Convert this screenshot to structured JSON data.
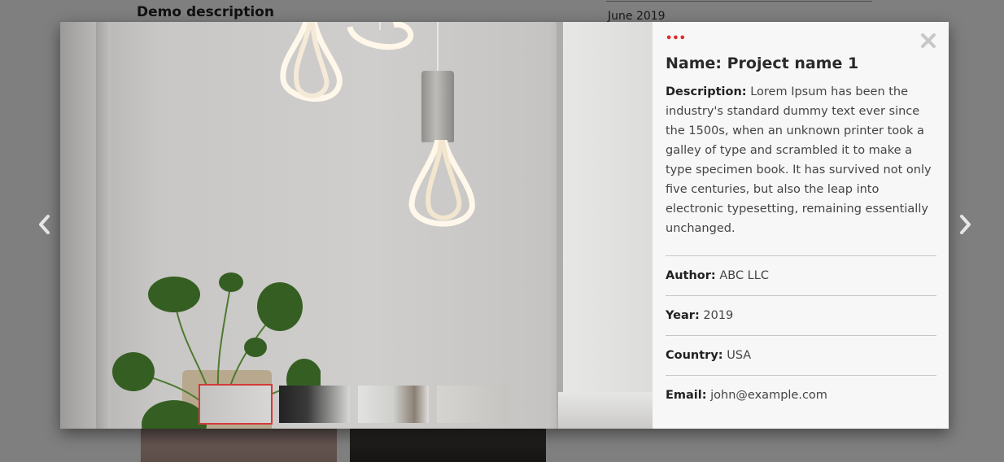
{
  "background": {
    "heading": "Demo description",
    "date": "June 2019"
  },
  "lightbox": {
    "nav": {
      "prev_icon": "chevron-left-icon",
      "next_icon": "chevron-right-icon"
    },
    "close_icon": "close-icon",
    "menu_dots": "•••",
    "thumbnails": [
      {
        "name": "thumb-1",
        "active": true
      },
      {
        "name": "thumb-2",
        "active": false
      },
      {
        "name": "thumb-3",
        "active": false
      },
      {
        "name": "thumb-4",
        "active": false
      }
    ],
    "info": {
      "title": "Name: Project name 1",
      "description_label": "Description:",
      "description_text": " Lorem Ipsum has been the industry's standard dummy text ever since the 1500s, when an unknown printer took a galley of type and scrambled it to make a type specimen book. It has survived not only five centuries, but also the leap into electronic typesetting, remaining essentially unchanged.",
      "fields": [
        {
          "label": "Author:",
          "value": " ABC LLC"
        },
        {
          "label": "Year:",
          "value": " 2019"
        },
        {
          "label": "Country:",
          "value": " USA"
        },
        {
          "label": "Email:",
          "value": " john@example.com"
        }
      ]
    },
    "colors": {
      "accent": "#d23a3a",
      "panel_bg": "#f7f7f7"
    }
  }
}
